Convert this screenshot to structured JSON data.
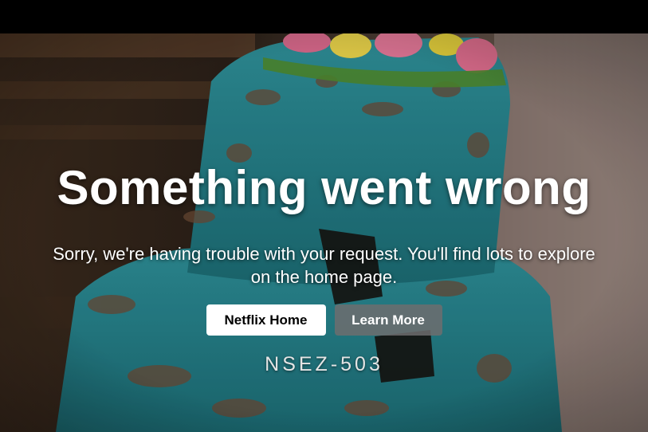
{
  "error_page": {
    "title": "Something went wrong",
    "message": "Sorry, we're having trouble with your request. You'll find lots to explore on the home page.",
    "buttons": {
      "home_label": "Netflix Home",
      "learn_more_label": "Learn More"
    },
    "error_code": "NSEZ-503"
  },
  "colors": {
    "top_bar": "#000000",
    "home_button_bg": "#ffffff",
    "learn_more_button_bg": "#6d6d6e",
    "text": "#ffffff"
  }
}
